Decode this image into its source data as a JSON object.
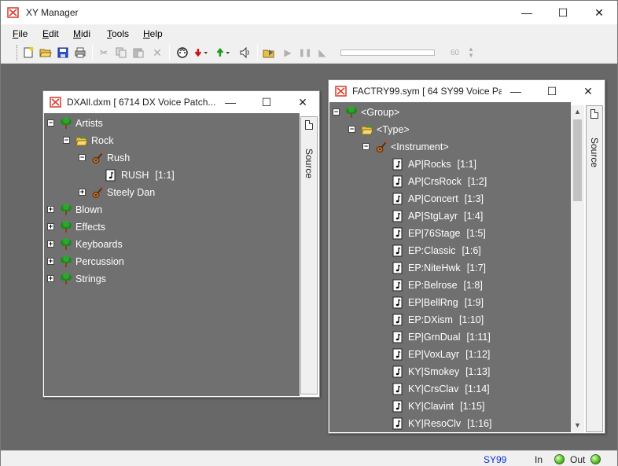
{
  "app": {
    "title": "XY Manager",
    "window_controls": {
      "minimize": "—",
      "maximize": "☐",
      "close": "✕"
    }
  },
  "menu": [
    {
      "label": "File",
      "accel": "F",
      "rest": "ile"
    },
    {
      "label": "Edit",
      "accel": "E",
      "rest": "dit"
    },
    {
      "label": "Midi",
      "accel": "M",
      "rest": "idi"
    },
    {
      "label": "Tools",
      "accel": "T",
      "rest": "ools"
    },
    {
      "label": "Help",
      "accel": "H",
      "rest": "elp"
    }
  ],
  "toolbar": {
    "icons": [
      "new-icon",
      "open-icon",
      "save-icon",
      "print-icon",
      "cut-icon",
      "copy-icon",
      "paste-icon",
      "delete-icon",
      "midi-icon",
      "receive-icon",
      "send-icon",
      "speaker-icon",
      "play-list-icon",
      "play-icon",
      "pause-icon",
      "stop-icon"
    ],
    "progress": 1.0,
    "spin_value": "60"
  },
  "left_window": {
    "title": "DXAll.dxm [ 6714 DX Voice Patch...",
    "side_tab": "Source",
    "tree": [
      {
        "label": "Artists",
        "icon": "tree-icon",
        "expander": "−"
      },
      {
        "label": "Rock",
        "icon": "folder-icon",
        "expander": "−"
      },
      {
        "label": "Rush",
        "icon": "guitar-icon",
        "expander": "−"
      },
      {
        "label": "RUSH",
        "num": "[1:1]",
        "icon": "note-icon",
        "expander": ""
      },
      {
        "label": "Steely Dan",
        "icon": "guitar-icon",
        "expander": "+"
      },
      {
        "label": "Blown",
        "icon": "tree-icon",
        "expander": "+"
      },
      {
        "label": "Effects",
        "icon": "tree-icon",
        "expander": "+"
      },
      {
        "label": "Keyboards",
        "icon": "tree-icon",
        "expander": "+"
      },
      {
        "label": "Percussion",
        "icon": "tree-icon",
        "expander": "+"
      },
      {
        "label": "Strings",
        "icon": "tree-icon",
        "expander": "+"
      }
    ]
  },
  "right_window": {
    "title": "FACTRY99.sym [ 64 SY99 Voice Pa...",
    "side_tab": "Source",
    "tree": [
      {
        "label": "<Group>",
        "icon": "tree-icon",
        "expander": "−"
      },
      {
        "label": "<Type>",
        "icon": "folder-icon",
        "expander": "−"
      },
      {
        "label": "<Instrument>",
        "icon": "guitar-icon",
        "expander": "−"
      },
      {
        "label": "AP|Rocks",
        "num": "[1:1]",
        "icon": "note-icon"
      },
      {
        "label": "AP|CrsRock",
        "num": "[1:2]",
        "icon": "note-icon"
      },
      {
        "label": "AP|Concert",
        "num": "[1:3]",
        "icon": "note-icon"
      },
      {
        "label": "AP|StgLayr",
        "num": "[1:4]",
        "icon": "note-icon"
      },
      {
        "label": "EP|76Stage",
        "num": "[1:5]",
        "icon": "note-icon"
      },
      {
        "label": "EP:Classic",
        "num": "[1:6]",
        "icon": "note-icon"
      },
      {
        "label": "EP:NiteHwk",
        "num": "[1:7]",
        "icon": "note-icon"
      },
      {
        "label": "EP:Belrose",
        "num": "[1:8]",
        "icon": "note-icon"
      },
      {
        "label": "EP|BellRng",
        "num": "[1:9]",
        "icon": "note-icon"
      },
      {
        "label": "EP:DXism",
        "num": "[1:10]",
        "icon": "note-icon"
      },
      {
        "label": "EP|GrnDual",
        "num": "[1:11]",
        "icon": "note-icon"
      },
      {
        "label": "EP|VoxLayr",
        "num": "[1:12]",
        "icon": "note-icon"
      },
      {
        "label": "KY|Smokey",
        "num": "[1:13]",
        "icon": "note-icon"
      },
      {
        "label": "KY|CrsClav",
        "num": "[1:14]",
        "icon": "note-icon"
      },
      {
        "label": "KY|Clavint",
        "num": "[1:15]",
        "icon": "note-icon"
      },
      {
        "label": "KY|ResoClv",
        "num": "[1:16]",
        "icon": "note-icon"
      }
    ]
  },
  "status": {
    "device": "SY99",
    "in_label": "In",
    "out_label": "Out",
    "device_color": "#0a2fd8",
    "led_color": "#5cc22c"
  }
}
